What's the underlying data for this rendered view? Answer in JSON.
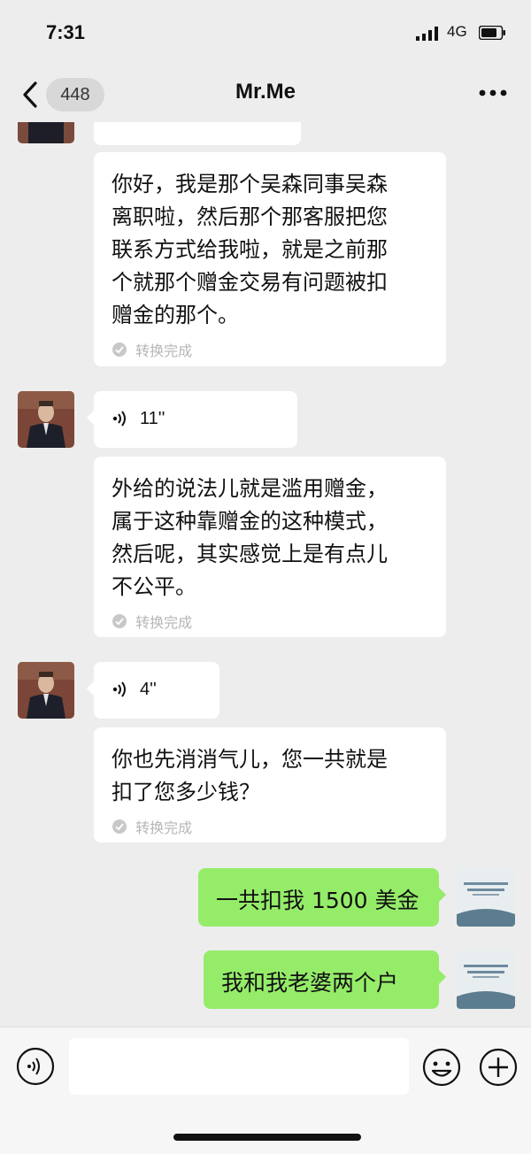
{
  "status": {
    "time": "7:31",
    "network": "4G"
  },
  "nav": {
    "unread_count": "448",
    "title": "Mr.Me"
  },
  "messages": [
    {
      "type": "transcript-partial"
    },
    {
      "type": "transcript",
      "text": "你好，我是那个吴森同事吴森\n离职啦，然后那个那客服把您\n联系方式给我啦，就是之前那\n个就那个赠金交易有问题被扣\n赠金的那个。",
      "status": "转换完成"
    },
    {
      "type": "voice",
      "duration": "11''"
    },
    {
      "type": "transcript",
      "text": "外给的说法儿就是滥用赠金，\n属于这种靠赠金的这种模式，\n然后呢，其实感觉上是有点儿\n不公平。",
      "status": "转换完成"
    },
    {
      "type": "voice",
      "duration": "4''"
    },
    {
      "type": "transcript",
      "text": "你也先消消气儿，您一共就是\n扣了您多少钱？",
      "status": "转换完成"
    },
    {
      "type": "text-out",
      "text": "一共扣我 1500 美金"
    },
    {
      "type": "text-out",
      "text": "我和我老婆两个户"
    }
  ],
  "colors": {
    "background": "#ededed",
    "bubble_out": "#95ec69",
    "bubble_in": "#ffffff"
  },
  "icons": [
    "back-icon",
    "more-icon",
    "signal-icon",
    "battery-icon",
    "voice-icon",
    "check-icon",
    "voice-toggle-icon",
    "emoji-icon",
    "plus-icon"
  ]
}
